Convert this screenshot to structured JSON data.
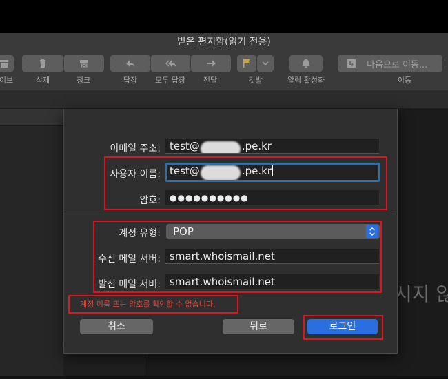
{
  "window": {
    "title": "받은 편지함(읽기 전용)"
  },
  "toolbar": {
    "archive_label": "아카이브",
    "archive_visible": "이브",
    "delete_label": "삭제",
    "junk_label": "정크",
    "reply_label": "답장",
    "reply_all_label": "모두 답장",
    "forward_label": "전달",
    "flag_label": "깃발",
    "notify_label": "알림 활성화",
    "move_button": "다음으로 이동...",
    "move_label": "이동"
  },
  "background": {
    "partial_text": "시지 않"
  },
  "form": {
    "email_label": "이메일 주소:",
    "email_prefix": "test@",
    "email_suffix": ".pe.kr",
    "username_label": "사용자 이름:",
    "username_prefix": "test@",
    "username_suffix": ".pe.kr",
    "password_label": "암호:",
    "password_value": "●●●●●●●●●●",
    "account_type_label": "계정 유형:",
    "account_type_value": "POP",
    "incoming_label": "수신 메일 서버:",
    "incoming_value": "smart.whoismail.net",
    "outgoing_label": "발신 메일 서버:",
    "outgoing_value": "smart.whoismail.net",
    "error_message": "계정 이름 또는 암호를 확인할 수 없습니다.",
    "cancel_button": "취소",
    "back_button": "뒤로",
    "login_button": "로그인"
  },
  "colors": {
    "accent": "#2a6ee0",
    "highlight_box": "#e0141b",
    "error_text": "#e0463a",
    "focus_ring": "#2f6fa6"
  }
}
